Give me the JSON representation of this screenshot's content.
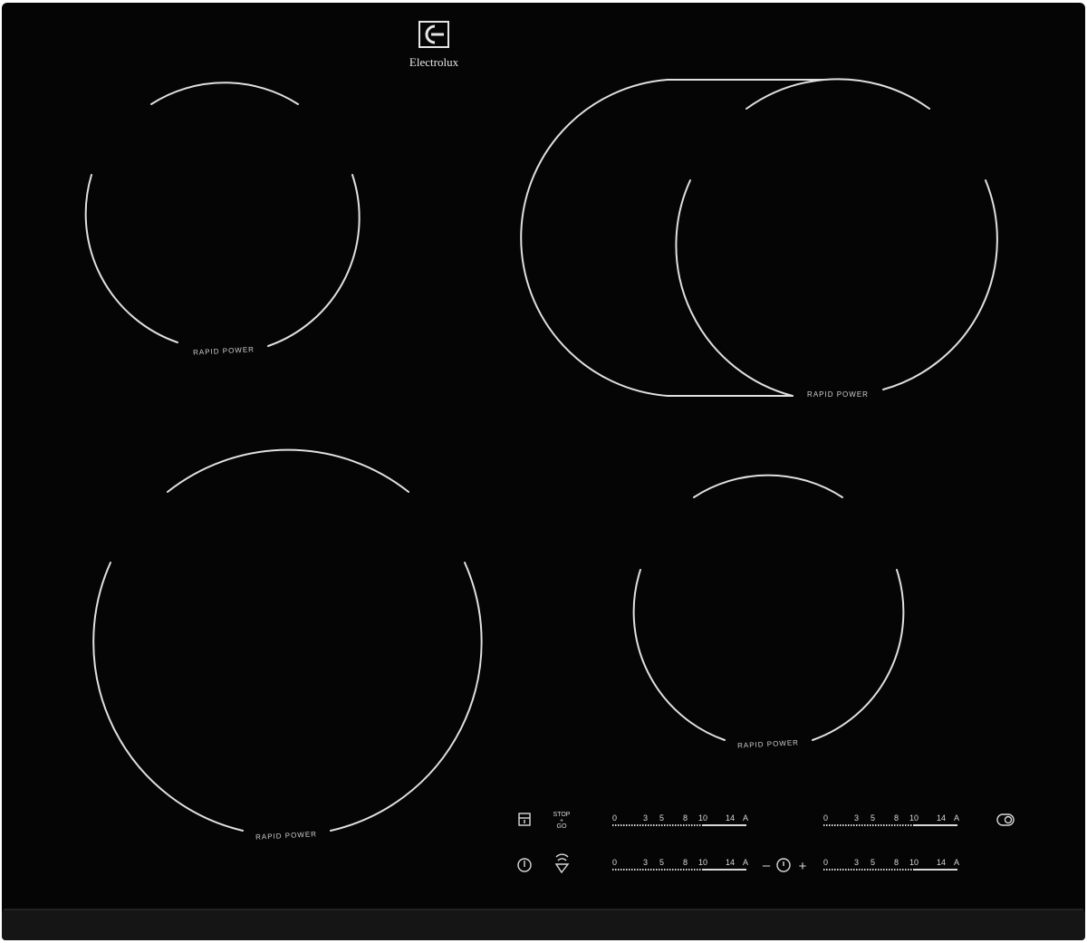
{
  "brand": {
    "name": "Electrolux",
    "logo_icon": "electrolux-logo-icon"
  },
  "zones": [
    {
      "label": "RAPID POWER"
    },
    {
      "label": "RAPID POWER"
    },
    {
      "label": "RAPID POWER"
    },
    {
      "label": "RAPID POWER"
    }
  ],
  "controls": {
    "stop_go": {
      "line1": "STOP",
      "line2": "+",
      "line3": "GO"
    },
    "scale_ticks": [
      "0",
      "3",
      "5",
      "8",
      "10",
      "14",
      "A"
    ],
    "timer_minus": "–",
    "timer_plus": "+",
    "icons": {
      "lock": "lock-icon",
      "power": "power-icon",
      "hob2hood": "hob2hood-icon",
      "timer": "timer-icon",
      "bridge": "bridge-icon"
    }
  },
  "colors": {
    "glass": "#050505",
    "frame_edge": "#1a1a1a",
    "markings": "#e0e0e0"
  }
}
